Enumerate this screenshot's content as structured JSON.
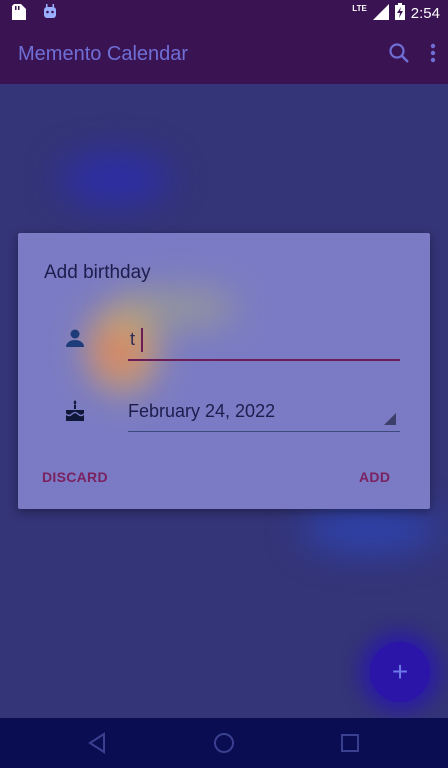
{
  "status_bar": {
    "network": "LTE",
    "time": "2:54"
  },
  "app_bar": {
    "title": "Memento Calendar"
  },
  "dialog": {
    "title": "Add birthday",
    "name_value": "t",
    "date_value": "February 24, 2022",
    "discard_label": "DISCARD",
    "add_label": "ADD"
  },
  "fab": {
    "label": "+"
  },
  "icons": {
    "sd_card": "sd-card-icon",
    "bug": "android-debug-icon",
    "signal": "cell-signal-icon",
    "battery": "battery-charging-icon",
    "search": "search-icon",
    "overflow": "overflow-menu-icon",
    "person": "person-icon",
    "cake": "cake-icon",
    "back": "nav-back-icon",
    "home": "nav-home-icon",
    "recents": "nav-recents-icon"
  },
  "colors": {
    "app_bar": "#3a1353",
    "dialog": "#7a7bc4",
    "accent": "#7b215f",
    "fab": "#2b14a8"
  }
}
